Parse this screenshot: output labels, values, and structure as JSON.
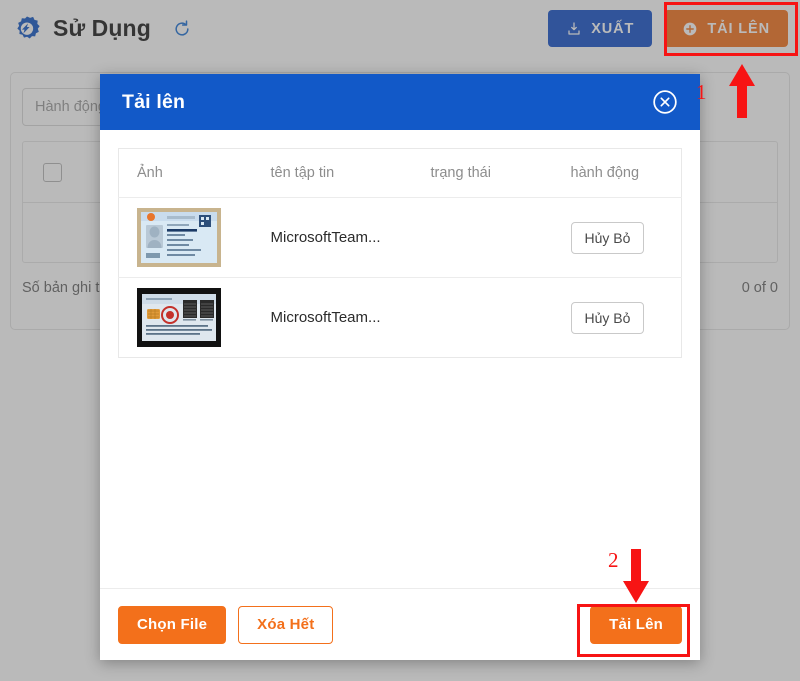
{
  "topbar": {
    "logo_icon": "gear-arrow-logo",
    "title": "Sử Dụng",
    "refresh_icon": "refresh-icon",
    "export_button": {
      "label": "XUẤT",
      "icon": "download-icon",
      "color": "#1450c8"
    },
    "upload_button": {
      "label": "TẢI LÊN",
      "icon": "plus-circle-icon",
      "color": "#f3701b"
    }
  },
  "background_page": {
    "filter_placeholder": "Hành động",
    "select_all_checkbox": "unchecked",
    "record_count_label": "Số bản ghi tr",
    "pagination_label": "0 of 0"
  },
  "modal": {
    "title": "Tải lên",
    "close_icon": "close-circle-icon",
    "table": {
      "columns": [
        "Ảnh",
        "tên tập tin",
        "trạng thái",
        "hành động"
      ],
      "rows": [
        {
          "thumbnail": "id-card-front-thumbnail",
          "filename": "MicrosoftTeam...",
          "status": "",
          "action_label": "Hủy Bỏ"
        },
        {
          "thumbnail": "id-card-back-thumbnail",
          "filename": "MicrosoftTeam...",
          "status": "",
          "action_label": "Hủy Bỏ"
        }
      ]
    },
    "footer": {
      "choose_file_label": "Chọn File",
      "clear_all_label": "Xóa Hết",
      "upload_label": "Tải Lên"
    }
  },
  "annotations": {
    "step_one": "1",
    "step_two": "2",
    "highlight_color": "#f71414"
  }
}
